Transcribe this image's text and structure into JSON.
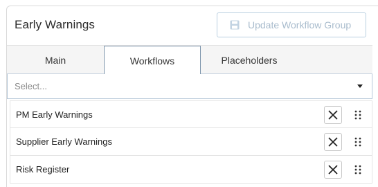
{
  "panel": {
    "title": "Early Warnings",
    "update_button": {
      "label": "Update Workflow Group",
      "icon": "save-icon"
    }
  },
  "tabs": [
    {
      "label": "Main",
      "active": false
    },
    {
      "label": "Workflows",
      "active": true
    },
    {
      "label": "Placeholders",
      "active": false
    }
  ],
  "select": {
    "placeholder": "Select...",
    "icon": "caret-down-icon"
  },
  "workflows": [
    {
      "name": "PM Early Warnings"
    },
    {
      "name": "Supplier Early Warnings"
    },
    {
      "name": "Risk Register"
    }
  ],
  "colors": {
    "button_border": "#b9cfe0",
    "button_text": "#a9bccd",
    "active_tab_border": "#7f97ad"
  }
}
